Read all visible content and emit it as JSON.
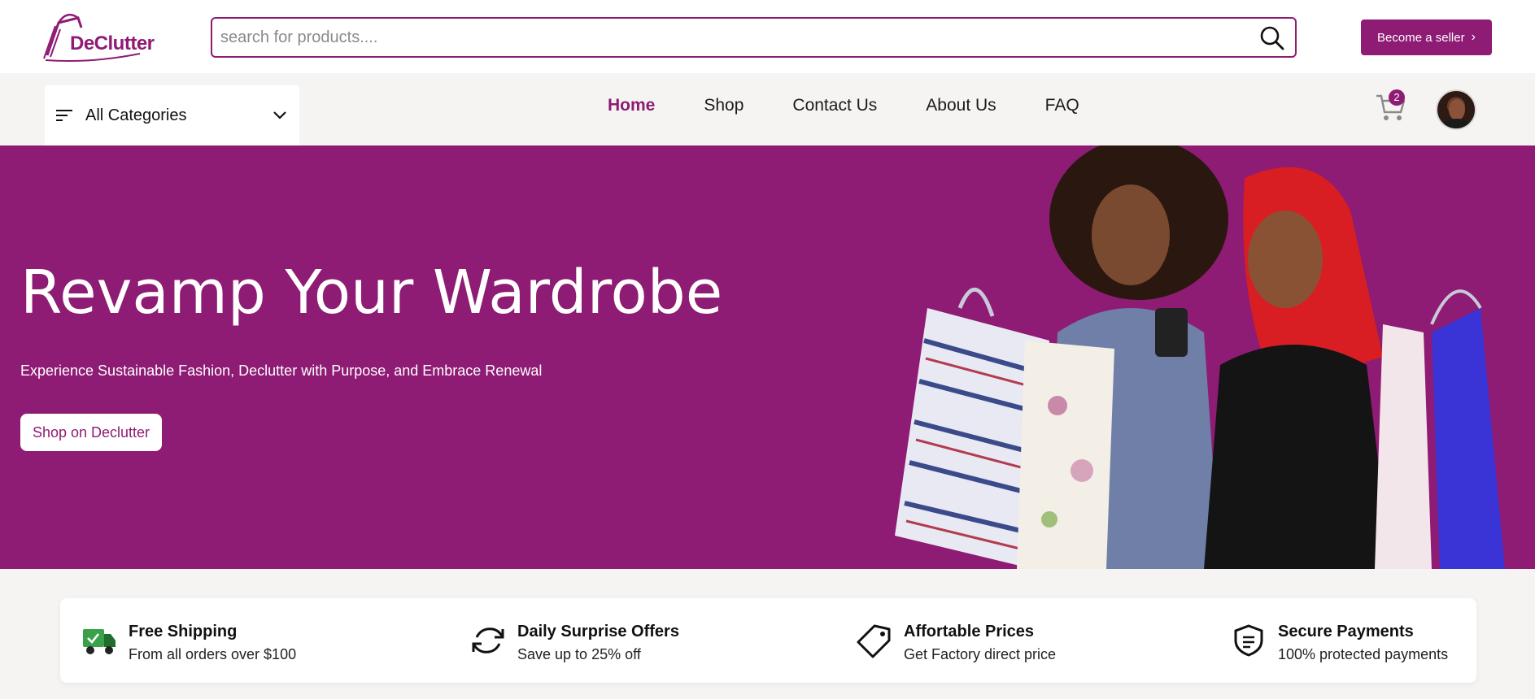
{
  "brand": {
    "logo_text": "DeClutter",
    "accent": "#8e1b74"
  },
  "search": {
    "placeholder": "search for products...."
  },
  "header": {
    "seller_button": "Become a seller"
  },
  "nav": {
    "categories_label": "All Categories",
    "links": [
      {
        "label": "Home",
        "active": true
      },
      {
        "label": "Shop",
        "active": false
      },
      {
        "label": "Contact Us",
        "active": false
      },
      {
        "label": "About Us",
        "active": false
      },
      {
        "label": "FAQ",
        "active": false
      }
    ],
    "cart_count": "2"
  },
  "hero": {
    "title": "Revamp Your Wardrobe",
    "subtitle": "Experience Sustainable Fashion, Declutter with Purpose, and Embrace Renewal",
    "button": "Shop on Declutter",
    "background": "#8e1b74"
  },
  "features": [
    {
      "icon": "truck-icon",
      "title": "Free Shipping",
      "desc": "From all orders over $100"
    },
    {
      "icon": "refresh-icon",
      "title": "Daily Surprise Offers",
      "desc": "Save up to 25% off"
    },
    {
      "icon": "price-tag-icon",
      "title": "Affortable Prices",
      "desc": "Get Factory direct price"
    },
    {
      "icon": "shield-payment-icon",
      "title": "Secure Payments",
      "desc": "100% protected payments"
    }
  ]
}
